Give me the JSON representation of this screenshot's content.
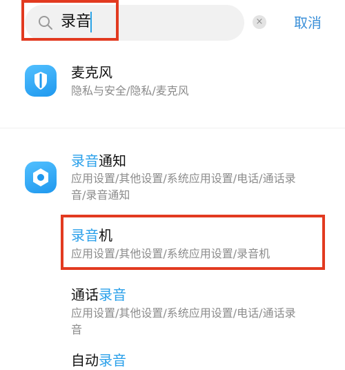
{
  "search": {
    "query": "录音",
    "cancel_label": "取消",
    "clear_symbol": "×"
  },
  "results": [
    {
      "title": "麦克风",
      "path": "隐私与安全/隐私/麦克风"
    },
    {
      "title_hl": "录音",
      "title_rest": "通知",
      "path_line1": "应用设置/其他设置/系统应用设置/电话/通话录",
      "path_line2": "音/录音通知"
    },
    {
      "title_hl": "录音",
      "title_rest": "机",
      "path": "应用设置/其他设置/系统应用设置/录音机"
    },
    {
      "title_pre": "通话",
      "title_hl": "录音",
      "path_line1": "应用设置/其他设置/系统应用设置/电话/通话录",
      "path_line2": "音"
    },
    {
      "title_pre": "自动",
      "title_hl": "录音"
    }
  ],
  "icons": {
    "privacy": "shield-icon",
    "settings": "settings-gear-icon",
    "search": "search-icon",
    "clear": "clear-icon"
  },
  "colors": {
    "highlight": "#2aa0ea",
    "annotation": "#e23a20",
    "icon_bg": "#1f98ee"
  }
}
